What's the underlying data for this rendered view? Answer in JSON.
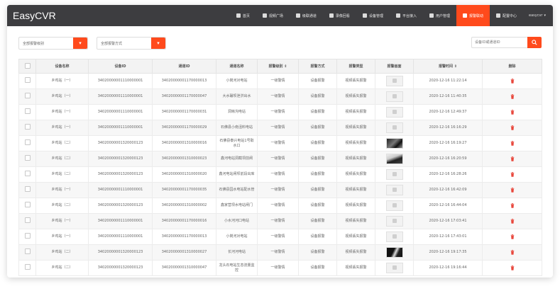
{
  "app": {
    "title": "EasyCVR"
  },
  "nav": [
    {
      "label": "首页",
      "icon": "home-icon",
      "active": false
    },
    {
      "label": "视频广场",
      "icon": "play-icon",
      "active": false
    },
    {
      "label": "级联通道",
      "icon": "cascade-icon",
      "active": false
    },
    {
      "label": "录像回看",
      "icon": "camera-icon",
      "active": false
    },
    {
      "label": "设备管理",
      "icon": "device-icon",
      "active": false
    },
    {
      "label": "平台接入",
      "icon": "platform-icon",
      "active": false
    },
    {
      "label": "用户管理",
      "icon": "user-icon",
      "active": false
    },
    {
      "label": "报警联动",
      "icon": "alarm-icon",
      "active": true
    },
    {
      "label": "配置中心",
      "icon": "config-icon",
      "active": false
    }
  ],
  "user": {
    "name": "easycvr"
  },
  "filters": {
    "alarm_level": "全部报警级别",
    "alarm_method": "全部报警方式"
  },
  "search": {
    "placeholder": "设备ID或通道ID"
  },
  "table": {
    "headers": [
      "设备名称",
      "设备ID",
      "通道ID",
      "通道名称",
      "报警级别",
      "报警方式",
      "报警类型",
      "报警画面",
      "报警时间",
      "删除"
    ],
    "rows": [
      {
        "device_name": "乡鸡站（一）",
        "device_id": "34020000001110000001",
        "channel_id": "34020000001170000013",
        "channel_name": "小岗河对电站",
        "level": "一级警情",
        "method": "设备报警",
        "type": "视频丢失报警",
        "thumb": "placeholder",
        "time": "2020-12-16 11:22:14"
      },
      {
        "device_name": "乡鸡站（一）",
        "device_id": "34020000001110000001",
        "channel_id": "34020000001170000047",
        "channel_name": "大水碾坝泄洪出水",
        "level": "一级警情",
        "method": "设备报警",
        "type": "视频丢失报警",
        "thumb": "placeholder",
        "time": "2020-12-16 11:40:35"
      },
      {
        "device_name": "乡鸡站（一）",
        "device_id": "34020000001110000001",
        "channel_id": "34020000001170000031",
        "channel_name": "洞晰沟电站",
        "level": "一级警情",
        "method": "设备报警",
        "type": "视频丢失报警",
        "thumb": "placeholder",
        "time": "2020-12-16 12:49:37"
      },
      {
        "device_name": "乡鸡站（一）",
        "device_id": "34020000001110000001",
        "channel_id": "34020000001170000029",
        "channel_name": "石佛县小南沮料电站",
        "level": "一级警情",
        "method": "设备报警",
        "type": "视频丢失报警",
        "thumb": "placeholder",
        "time": "2020-12-16 16:16:29"
      },
      {
        "device_name": "乡鸡站（二）",
        "device_id": "34020000001320000123",
        "channel_id": "34020000001310000016",
        "channel_name": "石佛县泰兴电站1号取水口",
        "level": "一级警情",
        "method": "设备报警",
        "type": "视频丢失报警",
        "thumb": "dark",
        "time": "2020-12-16 16:19:27"
      },
      {
        "device_name": "乡鸡站（二）",
        "device_id": "34020000001320000123",
        "channel_id": "34020000001310000023",
        "channel_name": "鑫河电站洞截坝前闸",
        "level": "一级警情",
        "method": "设备报警",
        "type": "视频丢失报警",
        "thumb": "dark2",
        "time": "2020-12-16 16:20:59"
      },
      {
        "device_name": "乡鸡站（二）",
        "device_id": "34020000001320000123",
        "channel_id": "34020000001310000020",
        "channel_name": "鑫河电站闸坝前段出库",
        "level": "一级警情",
        "method": "设备报警",
        "type": "视频丢失报警",
        "thumb": "placeholder",
        "time": "2020-12-16 16:28:26"
      },
      {
        "device_name": "乡鸡站（一）",
        "device_id": "34020000001110000001",
        "channel_id": "34020000001170000035",
        "channel_name": "石佛县园水电站配水管",
        "level": "一级警情",
        "method": "设备报警",
        "type": "视频丢失报警",
        "thumb": "placeholder",
        "time": "2020-12-16 16:42:09"
      },
      {
        "device_name": "乡鸡站（二）",
        "device_id": "34020000001320000123",
        "channel_id": "34020000001310000002",
        "channel_name": "鑫家营坝水电站闸门",
        "level": "一级警情",
        "method": "设备报警",
        "type": "视频丢失报警",
        "thumb": "placeholder",
        "time": "2020-12-16 16:44:04"
      },
      {
        "device_name": "乡鸡站（一）",
        "device_id": "34020000001110000001",
        "channel_id": "34020000001170000016",
        "channel_name": "小水河河口电站",
        "level": "一级警情",
        "method": "设备报警",
        "type": "视频丢失报警",
        "thumb": "placeholder",
        "time": "2020-12-16 17:03:41"
      },
      {
        "device_name": "乡鸡站（一）",
        "device_id": "34020000001110000001",
        "channel_id": "34020000001170000013",
        "channel_name": "小岗河对电站",
        "level": "一级警情",
        "method": "设备报警",
        "type": "视频丢失报警",
        "thumb": "placeholder",
        "time": "2020-12-16 17:43:01"
      },
      {
        "device_name": "乡鸡站（二）",
        "device_id": "34020000001320000123",
        "channel_id": "34020000001310000027",
        "channel_name": "长河河电站",
        "level": "一级警情",
        "method": "设备报警",
        "type": "视频丢失报警",
        "thumb": "dark3",
        "time": "2020-12-16 19:17:35"
      },
      {
        "device_name": "乡鸡站（二）",
        "device_id": "34020000001320000123",
        "channel_id": "34020000001310000047",
        "channel_name": "龙头石电站生态流量监控",
        "level": "一级警情",
        "method": "设备报警",
        "type": "视频丢失报警",
        "thumb": "placeholder",
        "time": "2020-12-16 19:16:44"
      }
    ]
  },
  "colors": {
    "accent": "#ff4a1c",
    "topbar": "#3d3d40",
    "delete": "#e8473c"
  }
}
